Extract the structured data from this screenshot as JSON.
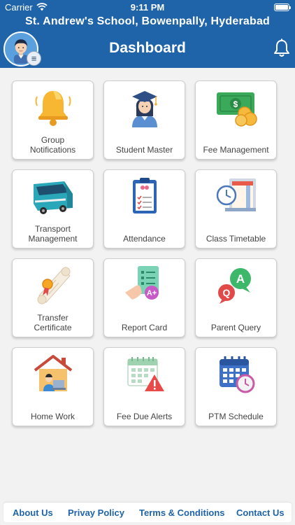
{
  "status_bar": {
    "carrier": "Carrier",
    "time": "9:11 PM"
  },
  "header": {
    "school_name": "St. Andrew's School, Bowenpally, Hyderabad",
    "title": "Dashboard",
    "brand_color": "#1f64a8"
  },
  "tiles": [
    {
      "label": "Group\nNotifications",
      "icon": "bell-icon"
    },
    {
      "label": "Student Master",
      "icon": "graduate-student-icon"
    },
    {
      "label": "Fee Management",
      "icon": "money-coins-icon"
    },
    {
      "label": "Transport\nManagement",
      "icon": "bus-icon"
    },
    {
      "label": "Attendance",
      "icon": "clipboard-checklist-icon"
    },
    {
      "label": "Class Timetable",
      "icon": "clock-board-icon"
    },
    {
      "label": "Transfer\nCertificate",
      "icon": "scroll-certificate-icon"
    },
    {
      "label": "Report Card",
      "icon": "report-card-icon"
    },
    {
      "label": "Parent Query",
      "icon": "qa-chat-icon"
    },
    {
      "label": "Home Work",
      "icon": "house-laptop-icon"
    },
    {
      "label": "Fee Due Alerts",
      "icon": "calendar-warning-icon"
    },
    {
      "label": "PTM Schedule",
      "icon": "calendar-clock-icon"
    }
  ],
  "footer": {
    "about": "About Us",
    "privacy": "Privay Policy",
    "terms": "Terms & Conditions",
    "contact": "Contact Us"
  }
}
